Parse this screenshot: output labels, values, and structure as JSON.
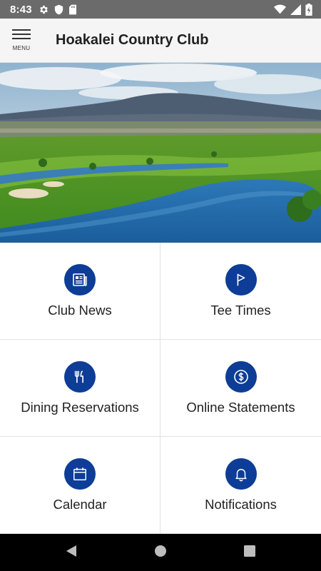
{
  "status_bar": {
    "time": "8:43",
    "left_icons": [
      "gear-icon",
      "shield-icon",
      "sd-card-icon"
    ],
    "right_icons": [
      "wifi-icon",
      "signal-icon",
      "battery-charging-icon"
    ]
  },
  "app_bar": {
    "menu_label": "MENU",
    "title": "Hoakalei Country Club"
  },
  "hero": {
    "description_icon": "golf-course-photo"
  },
  "tiles": [
    {
      "label": "Club News",
      "icon": "newspaper-icon"
    },
    {
      "label": "Tee Times",
      "icon": "flag-icon"
    },
    {
      "label": "Dining Reservations",
      "icon": "fork-knife-icon"
    },
    {
      "label": "Online Statements",
      "icon": "dollar-icon"
    },
    {
      "label": "Calendar",
      "icon": "calendar-icon"
    },
    {
      "label": "Notifications",
      "icon": "bell-icon"
    }
  ],
  "nav_bar": {
    "buttons": [
      "back-icon",
      "home-icon",
      "recents-icon"
    ]
  },
  "colors": {
    "accent": "#0d3d96",
    "status_bar": "#6b6b6b",
    "app_bar": "#f5f5f5",
    "nav_bar": "#000000"
  }
}
